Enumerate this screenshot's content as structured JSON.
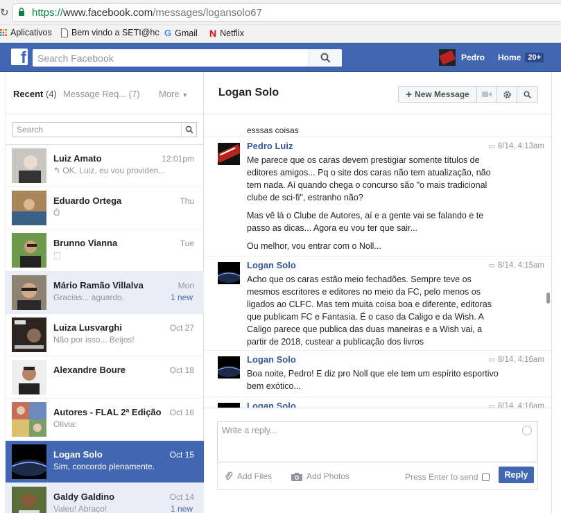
{
  "browser": {
    "url_scheme": "https://",
    "url_host": "www.facebook.com",
    "url_path": "/messages/logansolo67",
    "bookmarks": [
      {
        "label": "Aplicativos",
        "icon": "apps-grid-icon"
      },
      {
        "label": "Bem vindo a SETI@hc",
        "icon": "page-icon"
      },
      {
        "label": "Gmail",
        "icon": "google-g-icon"
      },
      {
        "label": "Netflix",
        "icon": "netflix-icon"
      }
    ]
  },
  "topbar": {
    "logo_letter": "f",
    "search_placeholder": "Search Facebook",
    "user_name": "Pedro",
    "home_label": "Home",
    "home_count": "20+"
  },
  "inbox": {
    "tab_recent": "Recent",
    "tab_recent_count": "(4)",
    "tab_requests": "Message Req... (7)",
    "tab_more": "More",
    "search_placeholder": "Search",
    "conversations": [
      {
        "name": "Luiz Amato",
        "time": "12:01pm",
        "snippet": "↰ OK, Luiz, eu vou providen...",
        "new": "",
        "state": "read"
      },
      {
        "name": "Eduardo Ortega",
        "time": "Thu",
        "snippet": "Ô",
        "new": "",
        "state": "read"
      },
      {
        "name": "Brunno Vianna",
        "time": "Tue",
        "snippet": "⬚",
        "new": "",
        "state": "read"
      },
      {
        "name": "Mário Ramão Villalva",
        "time": "Mon",
        "snippet": "Gracias... aguardo.",
        "new": "1 new",
        "state": "unread"
      },
      {
        "name": "Luiza Lusvarghi",
        "time": "Oct 27",
        "snippet": "Não por isso... Beijos!",
        "new": "",
        "state": "read"
      },
      {
        "name": "Alexandre Boure",
        "time": "Oct 18",
        "snippet": "",
        "new": "",
        "state": "read"
      },
      {
        "name": "Autores - FLAL 2ª Edição",
        "time": "Oct 16",
        "snippet": "Olívia:",
        "new": "",
        "state": "read"
      },
      {
        "name": "Logan Solo",
        "time": "Oct 15",
        "snippet": "Sim, concordo plenamente.",
        "new": "",
        "state": "selected"
      },
      {
        "name": "Galdy Galdino",
        "time": "Oct 14",
        "snippet": "Valeu! Abraço!",
        "new": "1 new",
        "state": "unread"
      }
    ]
  },
  "thread": {
    "title": "Logan Solo",
    "new_message_label": "New Message",
    "fragment_tail": "esssas coisas",
    "messages": [
      {
        "author": "Pedro Luiz",
        "time": "8/14, 4:13am",
        "paragraphs": [
          "Me parece que os caras devem prestigiar somente títulos de editores amigos... Pq o site dos caras não tem atualização, não tem nada. Aí quando chega o concurso são \"o mais tradicional clube de sci-fi\", estranho não?",
          "Mas vê lá o Clube de Autores, aí e a gente vai se falando e te passo as dicas... Agora eu vou ter que sair...",
          "Ou melhor, vou entrar com o Noll..."
        ]
      },
      {
        "author": "Logan Solo",
        "time": "8/14, 4:15am",
        "paragraphs": [
          "Acho que os caras estão meio fechadões. Sempre teve os mesmos escritores e editores no meio da FC, pelo menos os ligados ao CLFC. Mas tem muita coisa boa e diferente, editoras que publicam FC e Fantasia. É o caso da Caligo e da Wish. A Caligo parece que publica das duas maneiras e a Wish vai, a partir de 2018, custear a publicação dos livros"
        ]
      },
      {
        "author": "Logan Solo",
        "time": "8/14, 4:16am",
        "paragraphs": [
          "Boa noite, Pedro! E diz pro Noll que ele tem um espírito esportivo bem exótico..."
        ]
      },
      {
        "author": "Logan Solo",
        "time": "8/14, 4:16am",
        "paragraphs": []
      }
    ]
  },
  "composer": {
    "placeholder": "Write a reply...",
    "add_files": "Add Files",
    "add_photos": "Add Photos",
    "press_enter": "Press Enter to send",
    "reply_button": "Reply"
  },
  "colors": {
    "fb_blue": "#4267b2",
    "link_blue": "#365899",
    "unread_bg": "#eaedf5",
    "muted_text": "#90949c"
  }
}
